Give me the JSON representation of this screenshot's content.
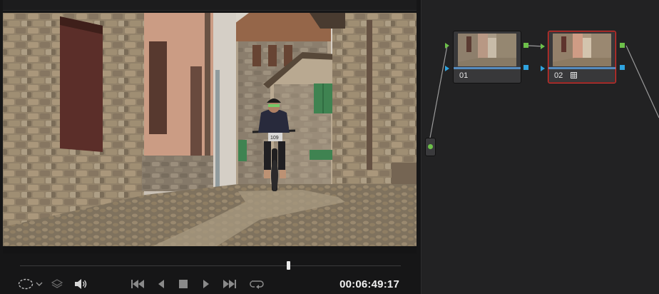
{
  "viewer": {
    "timecode": "00:06:49:17",
    "playhead_position": 0.705
  },
  "controls": {
    "icons": [
      "selection-icon",
      "chevron-down-icon",
      "layers-icon",
      "speaker-icon",
      "skip-to-start-icon",
      "step-back-icon",
      "stop-icon",
      "play-icon",
      "skip-to-end-icon",
      "loop-icon"
    ]
  },
  "nodes": [
    {
      "label": "01",
      "selected": false
    },
    {
      "label": "02",
      "selected": true,
      "icon": "grid-icon"
    }
  ],
  "colors": {
    "input_green": "#6dc04a",
    "input_blue": "#2fa3df",
    "selected_border": "#d33a36"
  }
}
